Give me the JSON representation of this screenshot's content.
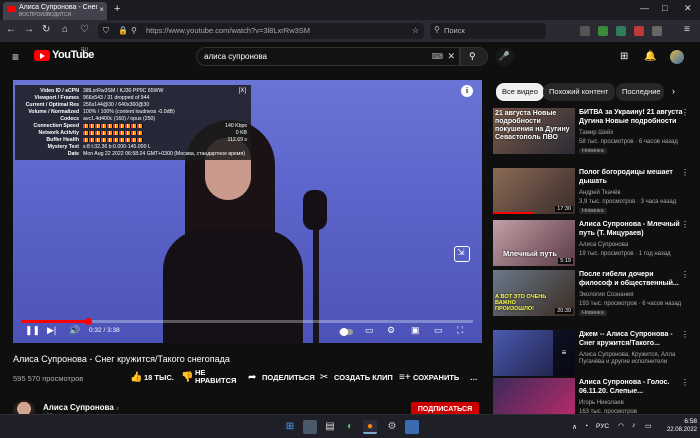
{
  "browser": {
    "tab_title": "Алиса Супронова - Снег кружится",
    "tab_subtitle": "ВОСПРОИЗВОДИТСЯ",
    "tab_close": "×",
    "new_tab": "+",
    "url": "https://www.youtube.com/watch?v=3l8LxrRw3SM",
    "search_placeholder": "Поиск",
    "win_min": "—",
    "win_max": "□",
    "win_close": "✕"
  },
  "youtube": {
    "logo_text": "YouTube",
    "logo_region": "RU",
    "search_query": "алиса супронова",
    "search_clear": "✕"
  },
  "player": {
    "time": "0:32 / 3:38",
    "progress_fraction": 0.147,
    "stats": {
      "close": "[X]",
      "rows": [
        {
          "label": "Video ID / sCPN",
          "value": "3l8LxrRw3SM  / KJ30 PP9C 65WW"
        },
        {
          "label": "Viewport / Frames",
          "value": "966x543 / 31 dropped of 944"
        },
        {
          "label": "Current / Optimal Res",
          "value": "256x144@30 / 640x360@30"
        },
        {
          "label": "Volume / Normalized",
          "value": "100% / 100% (content loudness -0.0dB)"
        },
        {
          "label": "Codecs",
          "value": "avc1.4d400c (160) / opus (250)"
        },
        {
          "label": "Connection Speed",
          "value": "140 Kbps"
        },
        {
          "label": "Network Activity",
          "value": "0 KB"
        },
        {
          "label": "Buffer Health",
          "value": "112.69 s"
        },
        {
          "label": "Mystery Text",
          "value": "s:8 t:32.36 b:0.000-145.000 L"
        },
        {
          "label": "Date",
          "value": "Mon Aug 22 2022 06:58:24 GMT+0300 (Москва, стандартное время)"
        }
      ]
    }
  },
  "video": {
    "title": "Алиса Супронова - Снег кружится/Такого снегопада",
    "views": "595 570 просмотров",
    "likes": "18 ТЫС.",
    "dislike": "НЕ НРАВИТСЯ",
    "share": "ПОДЕЛИТЬСЯ",
    "clip": "СОЗДАТЬ КЛИП",
    "save": "СОХРАНИТЬ",
    "more": "…",
    "channel": "Алиса Супронова",
    "channel_subs": "183",
    "subscribe": "ПОДПИСАТЬСЯ"
  },
  "chips": [
    "Все видео",
    "Похожий контент",
    "Последние"
  ],
  "recommendations": [
    {
      "title": "БИТВА за Украину! 21 августа Дугина Новые подробности",
      "channel": "Тамир Шейх",
      "meta": "58 тыс. просмотров · 6 часов назад",
      "badge": "Новинка",
      "thumb_text": "21 августа Новые подробности покушения на Дугину Севастополь ПВО"
    },
    {
      "title": "Полог богородицы мешает дышать",
      "channel": "Андрей Ткачёв",
      "meta": "3,9 тыс. просмотров · 3 часа назад",
      "badge": "Новинка",
      "duration": "17:30"
    },
    {
      "title": "Алиса Супронова - Млечный путь (Т. Мицураев)",
      "channel": "Алиса Супронова",
      "meta": "19 тыс. просмотров · 1 год назад",
      "duration": "5:19",
      "thumb_text": "Млечный путь"
    },
    {
      "title": "После гибели дочери философ и общественный...",
      "channel": "Экология Сознания",
      "meta": "193 тыс. просмотров · 6 часов назад",
      "badge": "Новинка",
      "duration": "20:30",
      "thumb_text": "А ВОТ ЭТО ОЧЕНЬ ВАЖНО ПРОИЗОШЛО!"
    },
    {
      "title": "Джем -- Алиса Супронова - Снег кружится/Такого...",
      "channel": "Алиса Супронова, Кружится, Алла Пугачёва и другие исполнители",
      "meta": ""
    },
    {
      "title": "Алиса Супронова - Голос. 06.11.20. Слепые...",
      "channel": "Игорь Николаев",
      "meta": "163 тыс. просмотров"
    }
  ],
  "taskbar": {
    "lang": "РУС",
    "time": "6:58",
    "date": "22.08.2022"
  },
  "colors": {
    "accent": "#ff0000",
    "subscribe_bg": "#cc0000",
    "background": "#0f0f0f",
    "player_bg": "#5d66cc"
  }
}
